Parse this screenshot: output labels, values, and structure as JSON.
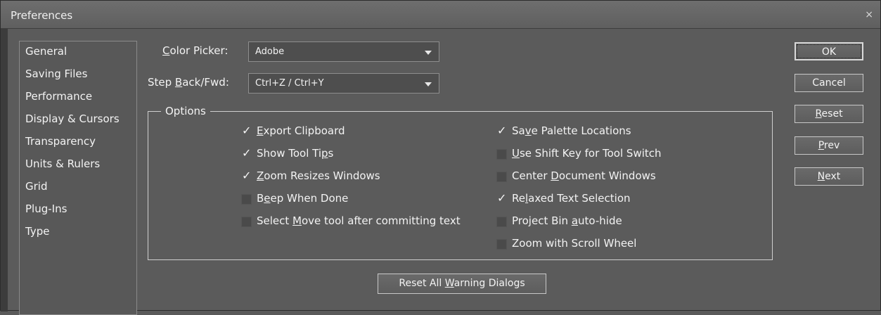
{
  "window": {
    "title": "Preferences",
    "close_glyph": "×"
  },
  "sidebar": {
    "items": [
      {
        "label": "General"
      },
      {
        "label": "Saving Files"
      },
      {
        "label": "Performance"
      },
      {
        "label": "Display & Cursors"
      },
      {
        "label": "Transparency"
      },
      {
        "label": "Units & Rulers"
      },
      {
        "label": "Grid"
      },
      {
        "label": "Plug-Ins"
      },
      {
        "label": "Type"
      }
    ]
  },
  "fields": {
    "color_picker": {
      "label_pre": "",
      "label_u": "C",
      "label_post": "olor Picker:",
      "value": "Adobe"
    },
    "step_back": {
      "label_pre": "Step ",
      "label_u": "B",
      "label_post": "ack/Fwd:",
      "value": "Ctrl+Z / Ctrl+Y"
    }
  },
  "options": {
    "title": "Options",
    "left": [
      {
        "pre": "",
        "u": "E",
        "post": "xport Clipboard",
        "checked": true
      },
      {
        "pre": "Show Tool Ti",
        "u": "p",
        "post": "s",
        "checked": true
      },
      {
        "pre": "",
        "u": "Z",
        "post": "oom Resizes Windows",
        "checked": true
      },
      {
        "pre": "B",
        "u": "e",
        "post": "ep When Done",
        "checked": false
      },
      {
        "pre": "Select ",
        "u": "M",
        "post": "ove tool after committing text",
        "checked": false
      }
    ],
    "right": [
      {
        "pre": "Sa",
        "u": "v",
        "post": "e Palette Locations",
        "checked": true
      },
      {
        "pre": "",
        "u": "U",
        "post": "se Shift Key for Tool Switch",
        "checked": false
      },
      {
        "pre": "Center ",
        "u": "D",
        "post": "ocument Windows",
        "checked": false
      },
      {
        "pre": "Re",
        "u": "l",
        "post": "axed Text Selection",
        "checked": true
      },
      {
        "pre": "Project Bin ",
        "u": "a",
        "post": "uto-hide",
        "checked": false
      },
      {
        "pre": "Zoom with Scroll Wheel",
        "u": "",
        "post": "",
        "checked": false
      }
    ],
    "tick_glyph": "✓"
  },
  "buttons": {
    "ok": {
      "pre": "OK",
      "u": "",
      "post": ""
    },
    "cancel": {
      "pre": "Cancel",
      "u": "",
      "post": ""
    },
    "reset": {
      "pre": "",
      "u": "R",
      "post": "eset"
    },
    "prev": {
      "pre": "",
      "u": "P",
      "post": "rev"
    },
    "next": {
      "pre": "",
      "u": "N",
      "post": "ext"
    },
    "reset_warnings": {
      "pre": "Reset All ",
      "u": "W",
      "post": "arning Dialogs"
    }
  }
}
